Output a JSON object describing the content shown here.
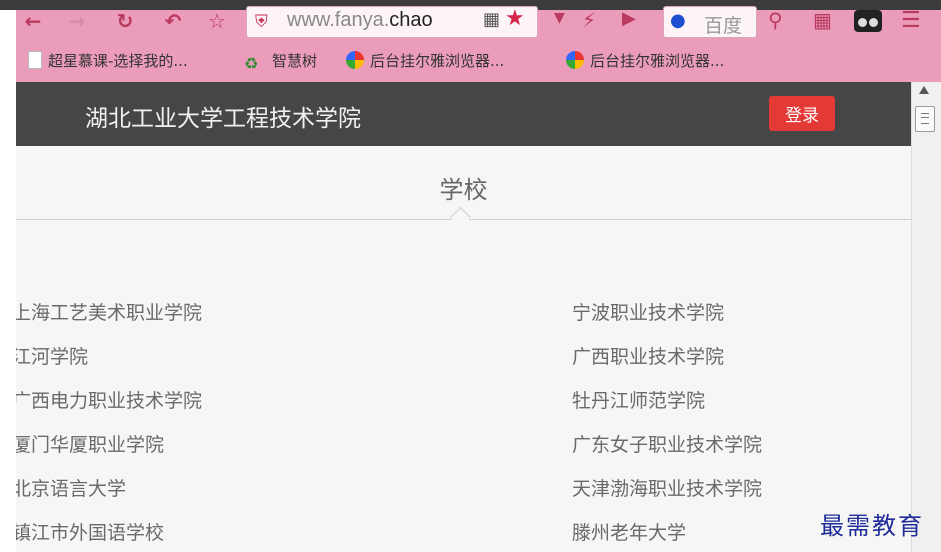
{
  "browser": {
    "address": {
      "prefix": "www.fanya.",
      "host": "chao"
    },
    "search_placeholder": "百度",
    "bookmarks": [
      {
        "label": "超星慕课-选择我的...",
        "icon": "page-icon"
      },
      {
        "label": "智慧树",
        "icon": "tree-icon"
      },
      {
        "label": "后台挂尔雅浏览器...",
        "icon": "colorful-icon"
      },
      {
        "label": "后台挂尔雅浏览器...",
        "icon": "colorful-icon"
      }
    ],
    "toolbar_icons": [
      "back-arrow-icon",
      "forward-arrow-icon",
      "refresh-icon",
      "undo-icon",
      "star-outline-icon",
      "shield-icon",
      "qr-code-icon",
      "star-icon",
      "dropdown-icon",
      "bolt-icon",
      "play-icon",
      "paw-icon",
      "magnifier-icon",
      "apps-icon",
      "avatar-icon",
      "menu-icon"
    ]
  },
  "header": {
    "site_title": "湖北工业大学工程技术学院",
    "login_label": "登录",
    "bg_color": "#464646",
    "login_color": "#e33a36"
  },
  "section": {
    "title": "学校"
  },
  "schools": {
    "left": [
      "上海工艺美术职业学院",
      "江河学院",
      "广西电力职业技术学院",
      "厦门华厦职业学院",
      "北京语言大学",
      "镇江市外国语学校"
    ],
    "right": [
      "宁波职业技术学院",
      "广西职业技术学院",
      "牡丹江师范学院",
      "广东女子职业技术学院",
      "天津渤海职业技术学院",
      "滕州老年大学"
    ]
  },
  "watermark": "最需教育"
}
